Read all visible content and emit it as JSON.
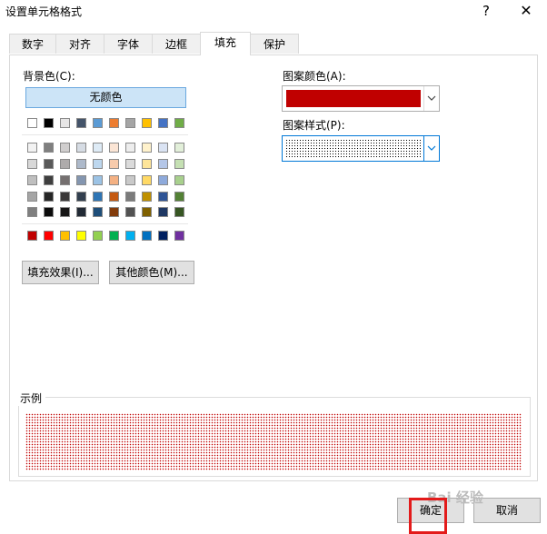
{
  "window": {
    "title": "设置单元格格式",
    "help": "?",
    "close": "✕"
  },
  "tabs": [
    "数字",
    "对齐",
    "字体",
    "边框",
    "填充",
    "保护"
  ],
  "active_tab": "填充",
  "fill": {
    "bg_label": "背景色(C):",
    "no_color": "无颜色",
    "theme_top": [
      "#ffffff",
      "#000000",
      "#e7e6e6",
      "#44546a",
      "#5b9bd5",
      "#ed7d31",
      "#a5a5a5",
      "#ffc000",
      "#4472c4",
      "#70ad47"
    ],
    "theme_tints": [
      [
        "#f2f2f2",
        "#7f7f7f",
        "#d0cece",
        "#d6dce4",
        "#deebf6",
        "#fbe5d5",
        "#ededed",
        "#fff2cc",
        "#dae3f3",
        "#e2efd9"
      ],
      [
        "#d8d8d8",
        "#595959",
        "#aeabab",
        "#adb9ca",
        "#bdd7ee",
        "#f7cbac",
        "#dbdbdb",
        "#fee599",
        "#b4c6e7",
        "#c5e0b3"
      ],
      [
        "#bfbfbf",
        "#3f3f3f",
        "#757070",
        "#8496b0",
        "#9cc3e5",
        "#f4b183",
        "#c9c9c9",
        "#ffd965",
        "#8eaadb",
        "#a8d08d"
      ],
      [
        "#a5a5a5",
        "#262626",
        "#3a3838",
        "#323f4f",
        "#2e75b5",
        "#c55a11",
        "#7b7b7b",
        "#bf9000",
        "#2f5496",
        "#538135"
      ],
      [
        "#7f7f7f",
        "#0c0c0c",
        "#171616",
        "#222a35",
        "#1e4e79",
        "#833c0b",
        "#525252",
        "#7f6000",
        "#1f3864",
        "#375623"
      ]
    ],
    "standard": [
      "#c00000",
      "#ff0000",
      "#ffc000",
      "#ffff00",
      "#92d050",
      "#00b050",
      "#00b0f0",
      "#0070c0",
      "#002060",
      "#7030a0"
    ],
    "fill_effects_label": "填充效果(I)...",
    "more_colors_label": "其他颜色(M)...",
    "pattern_color_label": "图案颜色(A):",
    "pattern_color_value": "#c00000",
    "pattern_style_label": "图案样式(P):",
    "sample_label": "示例"
  },
  "footer": {
    "ok": "确定",
    "cancel": "取消"
  },
  "watermark": "Bai 经验"
}
